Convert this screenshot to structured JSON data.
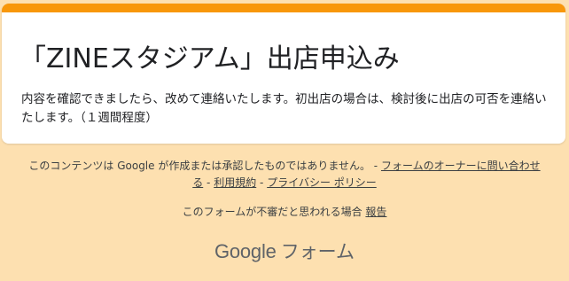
{
  "form": {
    "title": "「ZINEスタジアム」出店申込み",
    "description": "内容を確認できましたら、改めて連絡いたします。初出店の場合は、検討後に出店の可否を連絡いたします。（１週間程度）"
  },
  "footer": {
    "disclaimer_text": "このコンテンツは Google が作成または承認したものではありません。",
    "sep1": " - ",
    "contact_link": "フォームのオーナーに問い合わせる",
    "sep2": " - ",
    "terms_link": "利用規約",
    "sep3": " - ",
    "privacy_link": "プライバシー ポリシー",
    "report_text": "このフォームが不審だと思われる場合 ",
    "report_link": "報告",
    "brand_google": "Google",
    "brand_forms": "フォーム"
  },
  "colors": {
    "accent": "#f8970a",
    "background": "#fde0b0",
    "card": "#ffffff"
  }
}
